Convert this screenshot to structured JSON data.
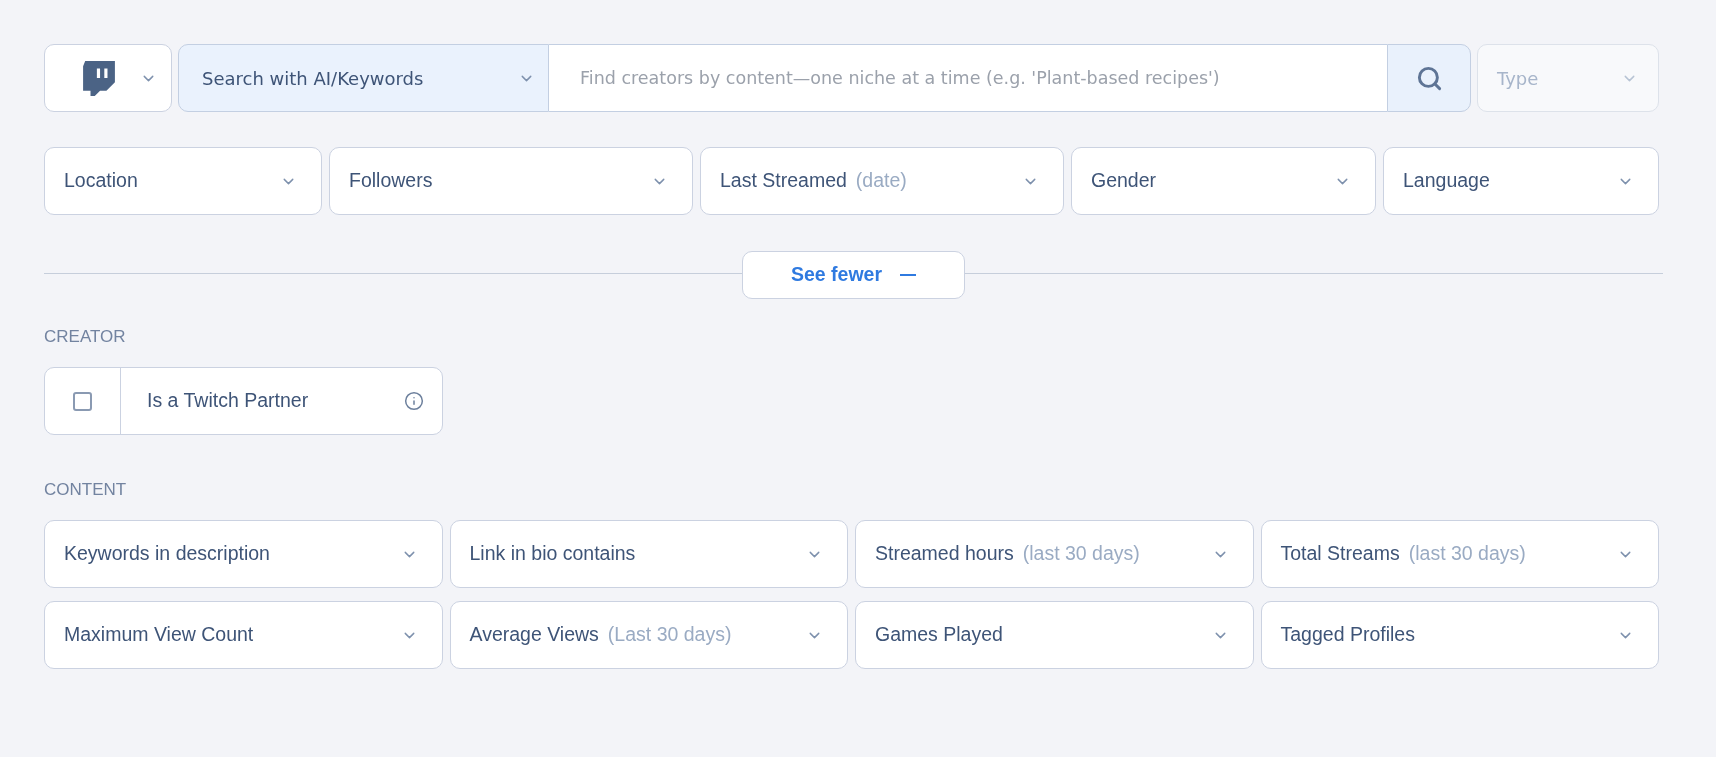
{
  "search_bar": {
    "mode": "Search with AI/Keywords",
    "placeholder": "Find creators by content—one niche at a time (e.g. 'Plant-based recipes')"
  },
  "type_select": {
    "placeholder": "Type",
    "disabled": true
  },
  "filters": [
    {
      "label": "Location"
    },
    {
      "label": "Followers"
    },
    {
      "label": "Last Streamed",
      "hint": "(date)"
    },
    {
      "label": "Gender"
    },
    {
      "label": "Language"
    }
  ],
  "toggle": {
    "label": "See fewer",
    "expanded": true
  },
  "sections": [
    {
      "title": "CREATOR",
      "items": [
        {
          "kind": "checkbox",
          "label": "Is a Twitch Partner",
          "checked": false
        }
      ]
    },
    {
      "title": "CONTENT",
      "items": [
        {
          "kind": "dropdown",
          "label": "Keywords in description"
        },
        {
          "kind": "dropdown",
          "label": "Link in bio contains"
        },
        {
          "kind": "dropdown",
          "label": "Streamed hours",
          "hint": "(last 30 days)"
        },
        {
          "kind": "dropdown",
          "label": "Total Streams",
          "hint": "(last 30 days)"
        },
        {
          "kind": "dropdown",
          "label": "Maximum View Count"
        },
        {
          "kind": "dropdown",
          "label": "Average Views",
          "hint": "(Last 30 days)"
        },
        {
          "kind": "dropdown",
          "label": "Games Played"
        },
        {
          "kind": "dropdown",
          "label": "Tagged Profiles"
        }
      ]
    }
  ]
}
